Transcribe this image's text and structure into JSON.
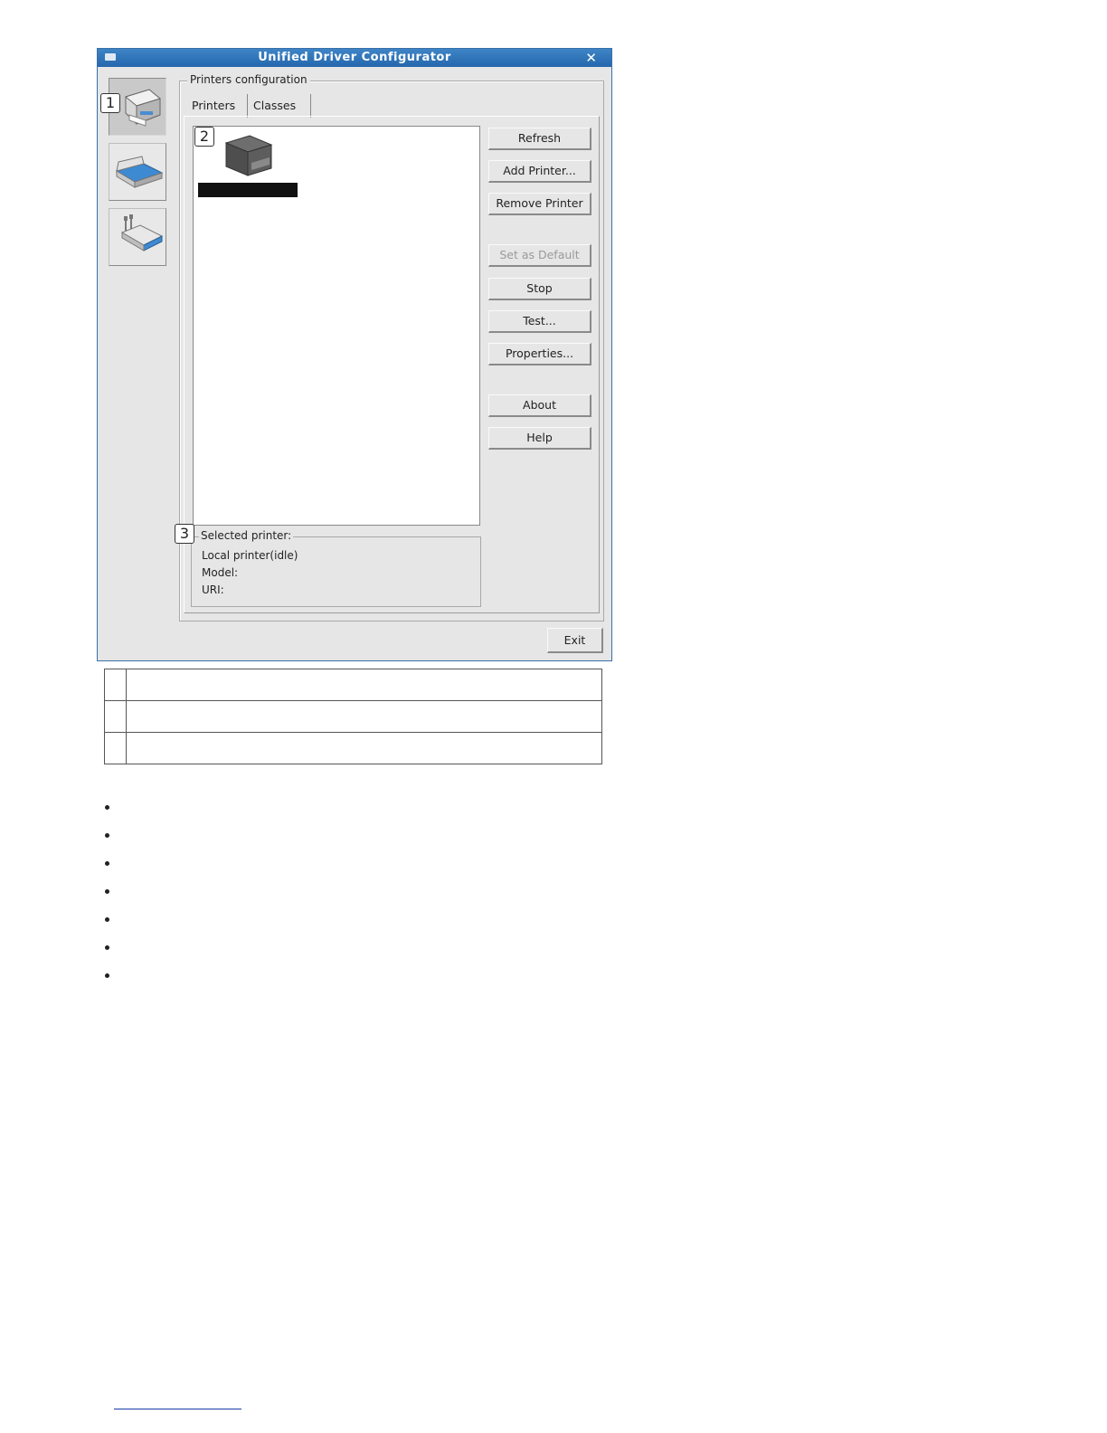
{
  "window": {
    "title": "Unified Driver Configurator",
    "close_glyph": "✕"
  },
  "sidebar": {
    "items": [
      {
        "icon": "printer-icon",
        "callout": "1",
        "active": true
      },
      {
        "icon": "scanner-icon"
      },
      {
        "icon": "port-icon"
      }
    ]
  },
  "printers_config": {
    "legend": "Printers configuration",
    "tabs": [
      {
        "label": "Printers",
        "selected": true
      },
      {
        "label": "Classes"
      }
    ],
    "list_callout": "2",
    "buttons": {
      "refresh": "Refresh",
      "add_printer": "Add Printer...",
      "remove_printer": "Remove Printer",
      "set_default": "Set as Default",
      "stop": "Stop",
      "test": "Test...",
      "properties": "Properties...",
      "about": "About",
      "help": "Help"
    },
    "selected": {
      "callout": "3",
      "legend": "Selected printer:",
      "status": "Local printer(idle)",
      "model_label": "Model:",
      "uri_label": "URI:"
    }
  },
  "exit_label": "Exit",
  "colors": {
    "titlebar": "#2f76bb",
    "window_bg": "#e6e6e6"
  }
}
